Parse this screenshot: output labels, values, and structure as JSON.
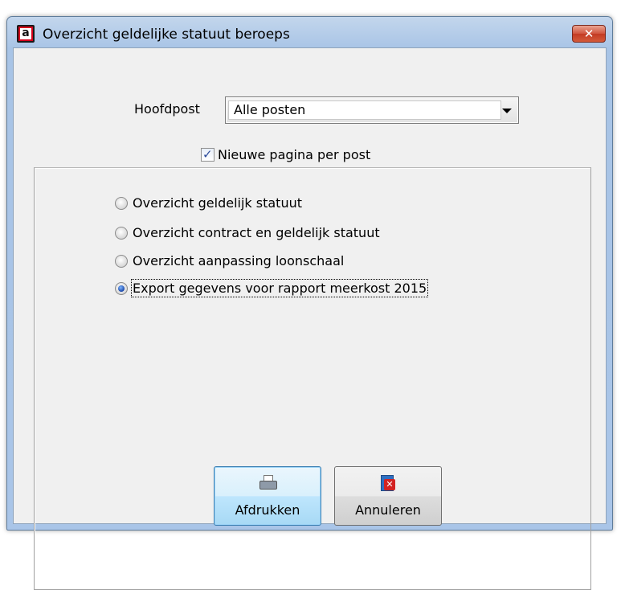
{
  "window": {
    "title": "Overzicht geldelijke statuut beroeps",
    "app_icon_glyph": "a",
    "close_glyph": "✕"
  },
  "form": {
    "hoofdpost_label": "Hoofdpost",
    "hoofdpost_value": "Alle posten",
    "new_page_checkbox": {
      "label": "Nieuwe pagina per post",
      "checked": true
    }
  },
  "report_options": [
    {
      "label": "Overzicht geldelijk statuut",
      "selected": false
    },
    {
      "label": "Overzicht contract en geldelijk statuut",
      "selected": false
    },
    {
      "label": "Overzicht aanpassing loonschaal",
      "selected": false
    },
    {
      "label": "Export gegevens voor rapport meerkost 2015",
      "selected": true
    }
  ],
  "buttons": {
    "print_label": "Afdrukken",
    "print_icon": "printer-icon",
    "cancel_label": "Annuleren",
    "cancel_icon": "cancel-icon"
  }
}
